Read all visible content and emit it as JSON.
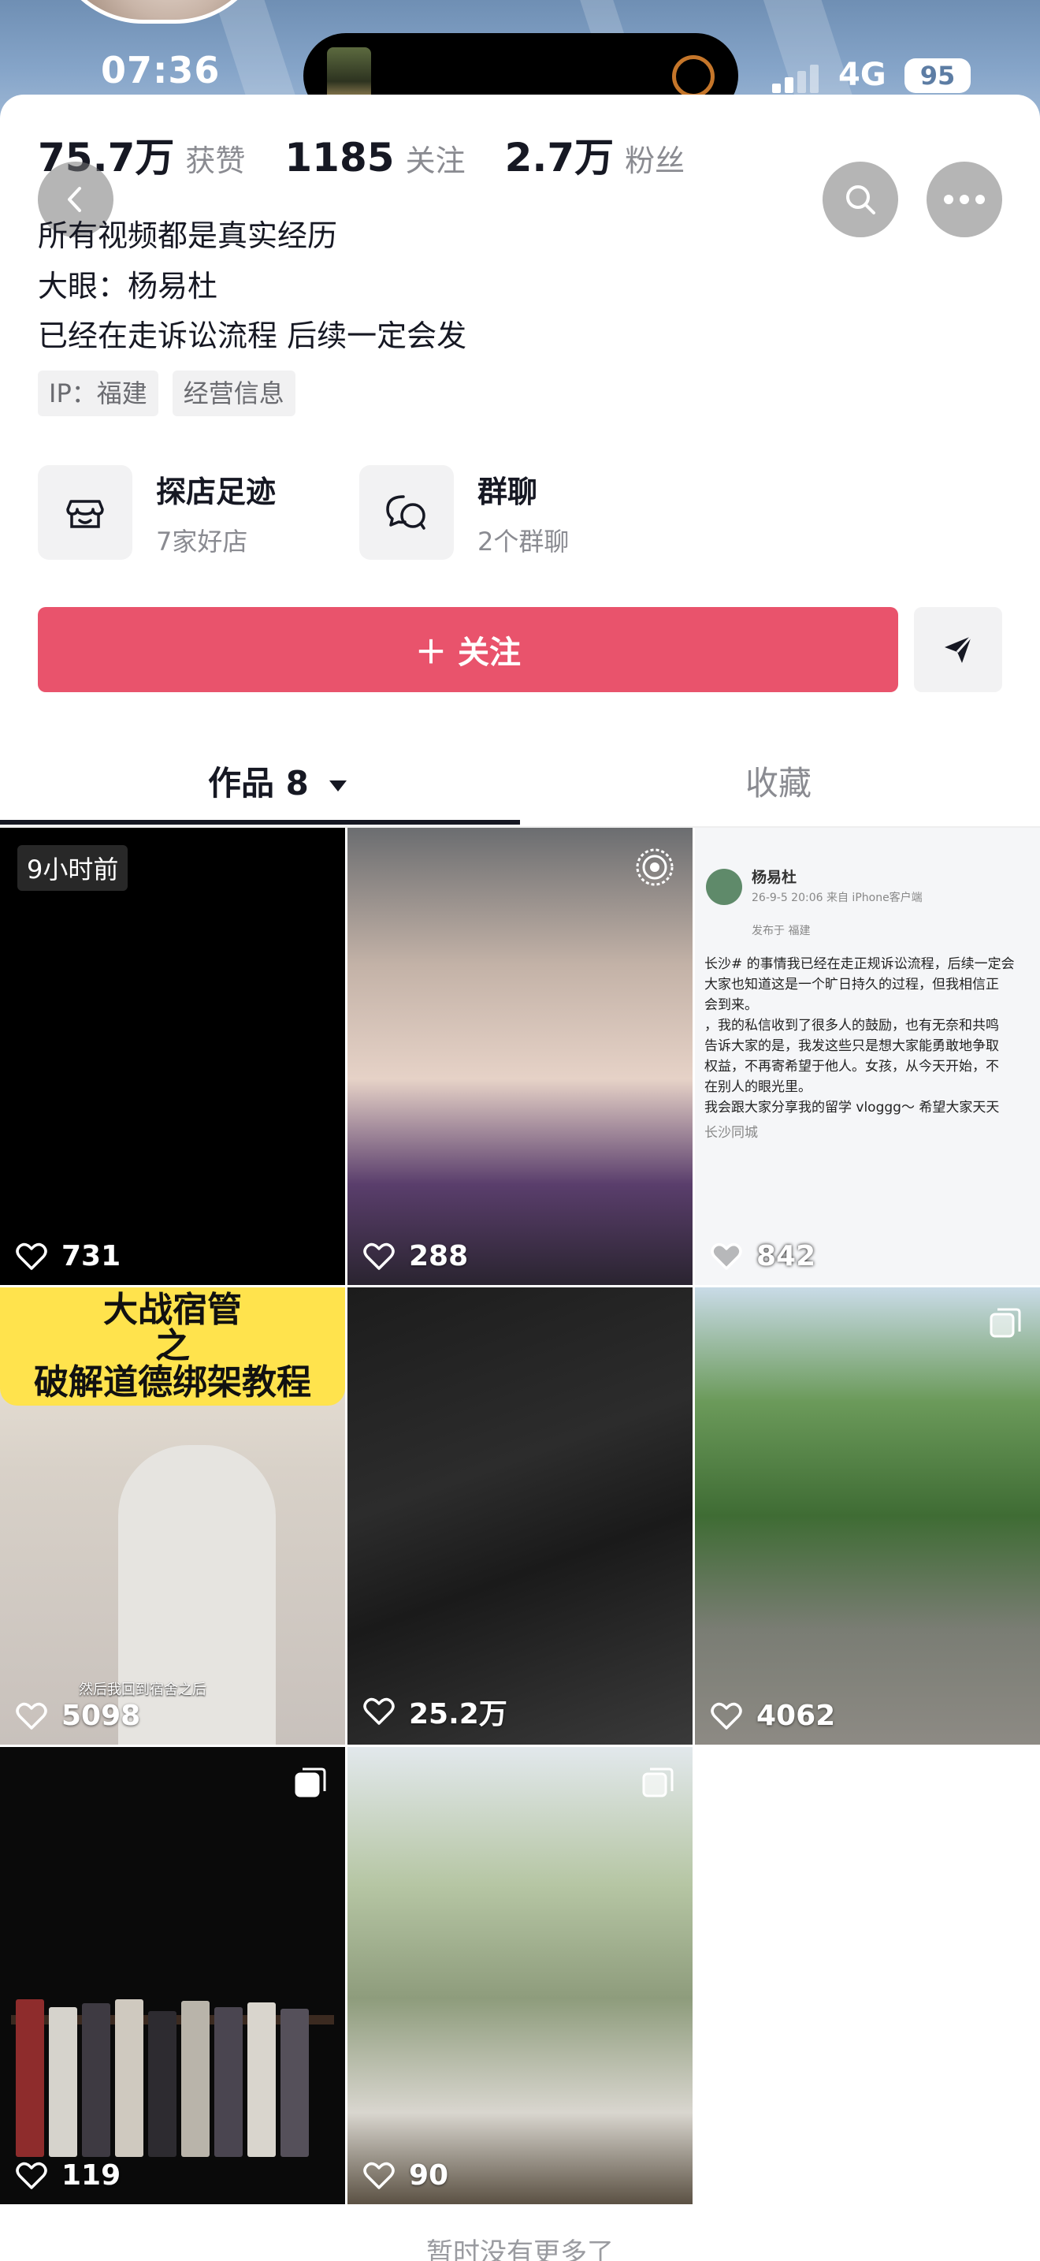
{
  "status_bar": {
    "time": "07:36",
    "network": "4G",
    "battery": "95"
  },
  "stats": [
    {
      "value": "75.7万",
      "label": "获赞"
    },
    {
      "value": "1185",
      "label": "关注"
    },
    {
      "value": "2.7万",
      "label": "粉丝"
    }
  ],
  "bio": [
    "所有视频都是真实经历",
    "大眼：杨易杜",
    "已经在走诉讼流程 后续一定会发"
  ],
  "tags": [
    "IP：福建",
    "经营信息"
  ],
  "features": [
    {
      "title": "探店足迹",
      "subtitle": "7家好店",
      "icon": "store-icon"
    },
    {
      "title": "群聊",
      "subtitle": "2个群聊",
      "icon": "chat-icon"
    }
  ],
  "follow_button": "＋ 关注",
  "tabs": {
    "works": "作品 8",
    "favorites": "收藏"
  },
  "videos": [
    {
      "likes": "731",
      "badge": "9小时前"
    },
    {
      "likes": "288"
    },
    {
      "likes": "842",
      "doc": {
        "name": "杨易杜",
        "meta": "26-9-5 20:06 来自 iPhone客户端",
        "loc": "发布于 福建",
        "lines": [
          "长沙# 的事情我已经在走正规诉讼流程，后续一定会",
          "大家也知道这是一个旷日持久的过程，但我相信正",
          "会到来。",
          "，我的私信收到了很多人的鼓励，也有无奈和共鸣",
          "告诉大家的是，我发这些只是想大家能勇敢地争取",
          "权益，不再寄希望于他人。女孩，从今天开始，不",
          "在别人的眼光里。",
          "我会跟大家分享我的留学 vloggg～ 希望大家天天",
          "长沙同城"
        ]
      }
    },
    {
      "likes": "5098",
      "banner": [
        "大战宿管",
        "之",
        "破解道德绑架教程"
      ],
      "caption": "然后我回到宿舍之后"
    },
    {
      "likes": "25.2万"
    },
    {
      "likes": "4062"
    },
    {
      "likes": "119"
    },
    {
      "likes": "90"
    }
  ],
  "footer": "暂时没有更多了",
  "colors": {
    "accent": "#e9536c",
    "header": "#7f9ec4"
  }
}
